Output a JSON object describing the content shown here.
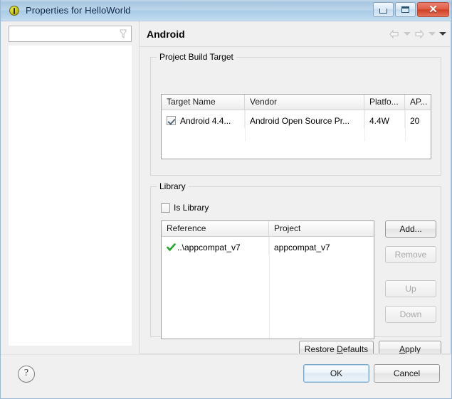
{
  "window": {
    "title": "Properties for HelloWorld",
    "icon": "properties-icon",
    "controls": {
      "minimize": "minimize-button",
      "maximize": "maximize-button",
      "close_glyph": "✕"
    }
  },
  "sidebar": {
    "filter": {
      "value": "",
      "placeholder": "",
      "icon": "filter-icon"
    },
    "tree_items": []
  },
  "page": {
    "title": "Android",
    "nav": {
      "back": "back-arrow",
      "back_menu": "back-dropdown",
      "forward": "forward-arrow",
      "forward_menu": "forward-dropdown",
      "menu": "view-menu"
    }
  },
  "build_target": {
    "group_label": "Project Build Target",
    "columns": [
      "Target Name",
      "Vendor",
      "Platfo...",
      "AP..."
    ],
    "rows": [
      {
        "checked": true,
        "target_name": "Android 4.4...",
        "vendor": "Android Open Source Pr...",
        "platform": "4.4W",
        "api": "20"
      }
    ]
  },
  "library": {
    "group_label": "Library",
    "is_library": {
      "label": "Is Library",
      "checked": false
    },
    "columns": [
      "Reference",
      "Project"
    ],
    "rows": [
      {
        "status_icon": "green-check-icon",
        "reference": "..\\appcompat_v7",
        "project": "appcompat_v7"
      }
    ],
    "buttons": [
      {
        "label": "Add...",
        "enabled": true
      },
      {
        "label": "Remove",
        "enabled": false
      },
      {
        "label": "Up",
        "enabled": false
      },
      {
        "label": "Down",
        "enabled": false
      }
    ]
  },
  "actions": {
    "restore_defaults": "Restore Defaults",
    "apply": "Apply",
    "ok": "OK",
    "cancel": "Cancel",
    "help": "?"
  },
  "colors": {
    "titlebar_accent": "#a9c6e0",
    "close_button": "#cf4026",
    "status_check": "#22a72a",
    "default_button_focus": "#7ba8c9"
  }
}
